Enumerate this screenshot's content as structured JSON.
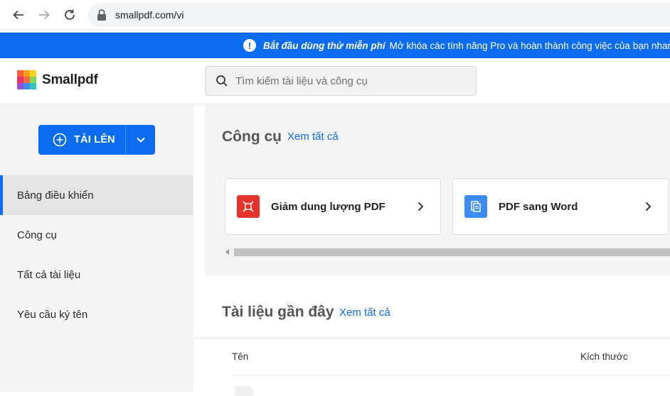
{
  "browser": {
    "url": "smallpdf.com/vi"
  },
  "promo": {
    "strong": "Bắt đầu dùng thử miễn phí",
    "text": "Mở khóa các tính năng Pro và hoàn thành công việc của bạn nhanh hơn"
  },
  "header": {
    "logo_text": "Smallpdf",
    "search_placeholder": "Tìm kiếm tài liệu và công cụ"
  },
  "sidebar": {
    "upload_label": "TẢI LÊN",
    "items": [
      {
        "label": "Bảng điều khiển",
        "active": true
      },
      {
        "label": "Công cụ",
        "active": false
      },
      {
        "label": "Tất cả tài liệu",
        "active": false
      },
      {
        "label": "Yêu cầu ký tên",
        "active": false
      }
    ]
  },
  "tools": {
    "title": "Công cụ",
    "see_all": "Xem tất cả",
    "cards": [
      {
        "name": "Giảm dung lượng PDF",
        "color": "#e5322d",
        "icon": "compress-icon"
      },
      {
        "name": "PDF sang Word",
        "color": "#3d8bf5",
        "icon": "word-doc-icon"
      }
    ]
  },
  "recent": {
    "title": "Tài liệu gần đây",
    "see_all": "Xem tất cả",
    "columns": [
      "Tên",
      "Kích thước"
    ]
  },
  "colors": {
    "brand": "#0b6cf2"
  }
}
